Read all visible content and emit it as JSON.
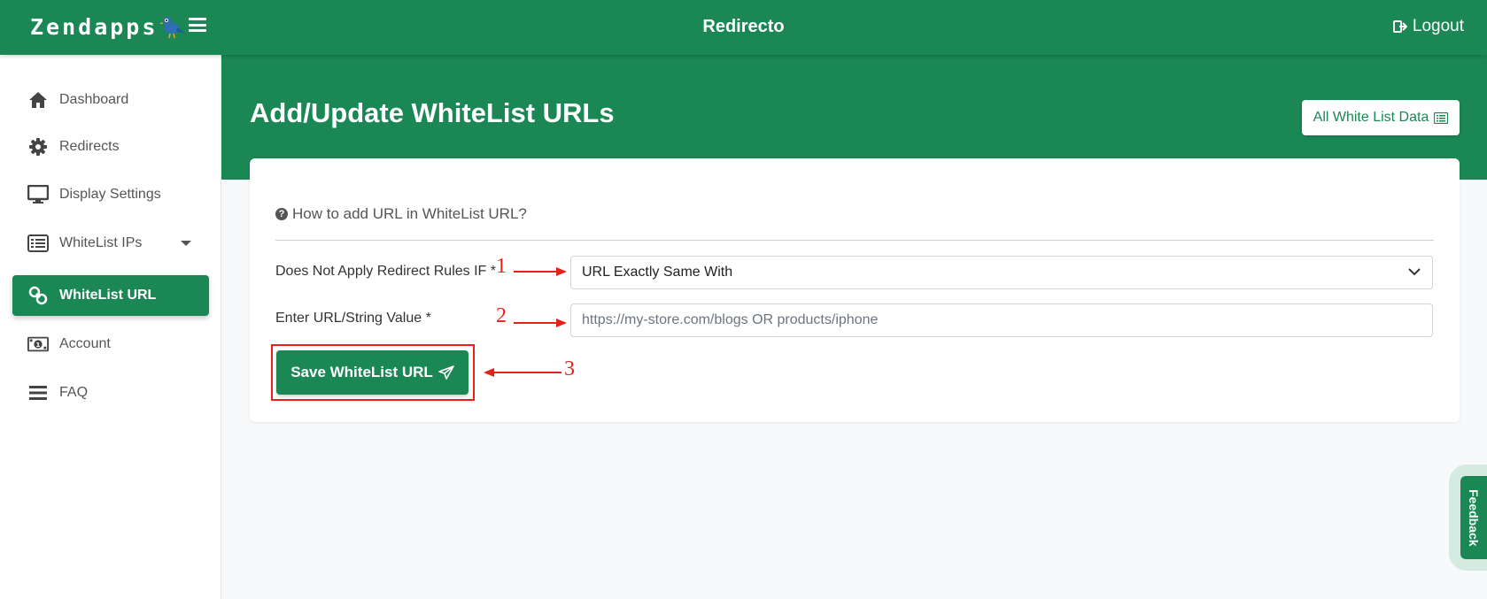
{
  "header": {
    "logo_text": "Zendapps",
    "app_title": "Redirecto",
    "logout_label": "Logout"
  },
  "sidebar": {
    "items": [
      {
        "label": "Dashboard",
        "icon": "home-icon"
      },
      {
        "label": "Redirects",
        "icon": "gear-icon"
      },
      {
        "label": "Display Settings",
        "icon": "monitor-icon"
      },
      {
        "label": "WhiteList IPs",
        "icon": "list-icon"
      },
      {
        "label": "WhiteList URL",
        "icon": "link-icon",
        "active": true
      },
      {
        "label": "Account",
        "icon": "money-icon"
      },
      {
        "label": "FAQ",
        "icon": "bars-icon"
      }
    ]
  },
  "main": {
    "title": "Add/Update WhiteList URLs",
    "all_data_button": "All White List Data",
    "howto_text": "How to add URL in WhiteList URL?",
    "rule_label": "Does Not Apply Redirect Rules IF *",
    "rule_selected": "URL Exactly Same With",
    "url_label": "Enter URL/String Value *",
    "url_placeholder": "https://my-store.com/blogs OR products/iphone",
    "url_value": "",
    "save_button": "Save WhiteList URL"
  },
  "annotations": {
    "marker_1": "1",
    "marker_2": "2",
    "marker_3": "3",
    "color": "#e8201a"
  },
  "feedback_label": "Feedback",
  "colors": {
    "brand_green": "#1a8754",
    "annotation_red": "#e8201a"
  }
}
